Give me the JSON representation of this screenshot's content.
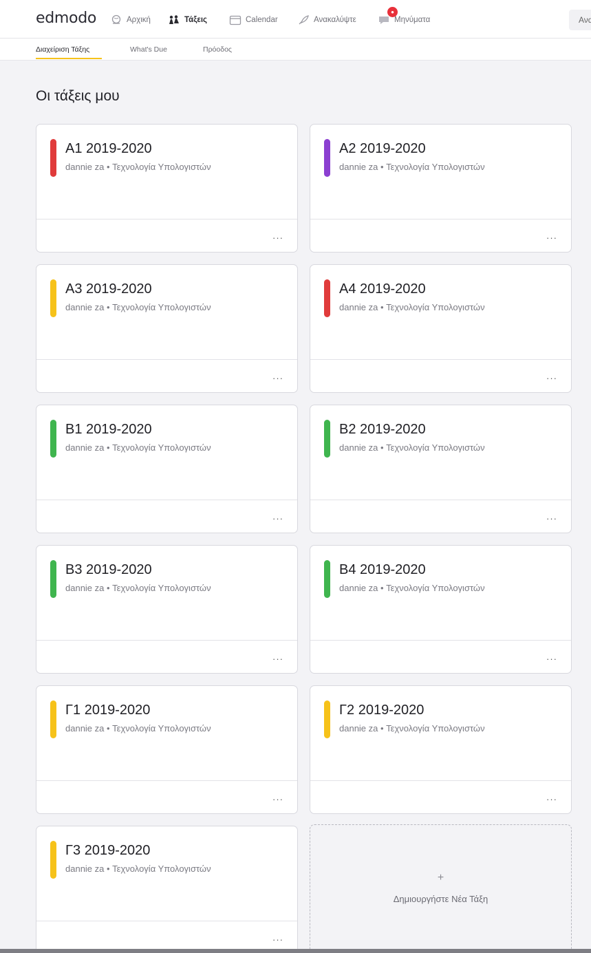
{
  "app": {
    "logo": "edmodo"
  },
  "nav": {
    "home": "Αρχική",
    "classes": "Τάξεις",
    "calendar": "Calendar",
    "discover": "Ανακαλύψτε",
    "messages": "Μηνύματα",
    "search_stub": "Ανα"
  },
  "subnav": {
    "manage": "Διαχείριση Τάξης",
    "whats_due": "What's Due",
    "progress": "Πρόοδος"
  },
  "page": {
    "title": "Οι τάξεις μου"
  },
  "classes": [
    {
      "name": "Α1 2019-2020",
      "subtitle": "dannie za • Τεχνολογία Υπολογιστών",
      "color": "#e03b3b",
      "more": "···"
    },
    {
      "name": "Α2 2019-2020",
      "subtitle": "dannie za • Τεχνολογία Υπολογιστών",
      "color": "#8b3fd1",
      "more": "···"
    },
    {
      "name": "Α3 2019-2020",
      "subtitle": "dannie za • Τεχνολογία Υπολογιστών",
      "color": "#f6c21a",
      "more": "···"
    },
    {
      "name": "Α4 2019-2020",
      "subtitle": "dannie za • Τεχνολογία Υπολογιστών",
      "color": "#e03b3b",
      "more": "···"
    },
    {
      "name": "Β1 2019-2020",
      "subtitle": "dannie za • Τεχνολογία Υπολογιστών",
      "color": "#3fb54e",
      "more": "···"
    },
    {
      "name": "Β2 2019-2020",
      "subtitle": "dannie za • Τεχνολογία Υπολογιστών",
      "color": "#3fb54e",
      "more": "···"
    },
    {
      "name": "Β3 2019-2020",
      "subtitle": "dannie za • Τεχνολογία Υπολογιστών",
      "color": "#3fb54e",
      "more": "···"
    },
    {
      "name": "Β4 2019-2020",
      "subtitle": "dannie za • Τεχνολογία Υπολογιστών",
      "color": "#3fb54e",
      "more": "···"
    },
    {
      "name": "Γ1 2019-2020",
      "subtitle": "dannie za • Τεχνολογία Υπολογιστών",
      "color": "#f6c21a",
      "more": "···"
    },
    {
      "name": "Γ2 2019-2020",
      "subtitle": "dannie za • Τεχνολογία Υπολογιστών",
      "color": "#f6c21a",
      "more": "···"
    },
    {
      "name": "Γ3 2019-2020",
      "subtitle": "dannie za • Τεχνολογία Υπολογιστών",
      "color": "#f6c21a",
      "more": "···"
    }
  ],
  "new_class": {
    "plus": "+",
    "label": "Δημιουργήστε Νέα Τάξη"
  },
  "colors": {
    "accent": "#f6c21a",
    "badge": "#e8303a"
  }
}
